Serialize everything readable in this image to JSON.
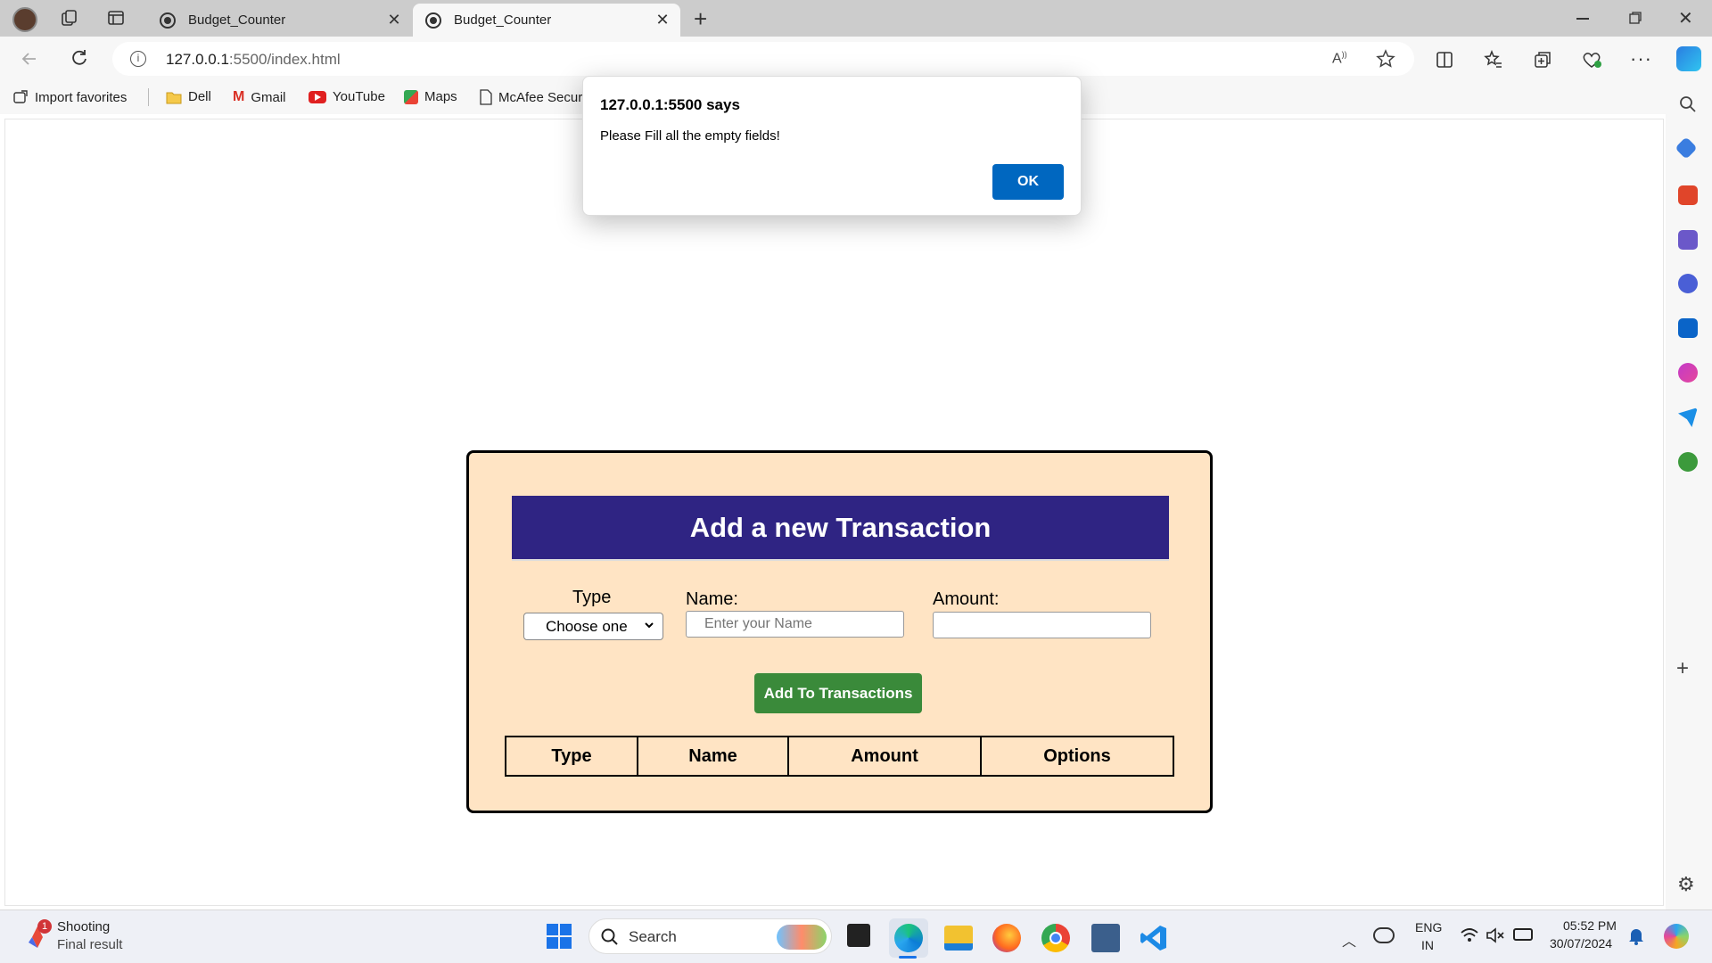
{
  "browser": {
    "tabs": [
      {
        "title": "Budget_Counter",
        "active": false
      },
      {
        "title": "Budget_Counter",
        "active": true
      }
    ],
    "url_host": "127.0.0.1",
    "url_rest": ":5500/index.html",
    "favorites": [
      "Import favorites",
      "Dell",
      "Gmail",
      "YouTube",
      "Maps",
      "McAfee Secur"
    ]
  },
  "dialog": {
    "title": "127.0.0.1:5500 says",
    "message": "Please Fill all the empty fields!",
    "ok_label": "OK"
  },
  "form": {
    "heading": "Add a new Transaction",
    "type_label": "Type",
    "type_selected": "Choose one",
    "name_label": "Name:",
    "name_placeholder": "Enter your Name",
    "amount_label": "Amount:",
    "amount_value": "",
    "submit_label": "Add To Transactions"
  },
  "table": {
    "headers": [
      "Type",
      "Name",
      "Amount",
      "Options"
    ]
  },
  "taskbar": {
    "notification_title": "Shooting",
    "notification_sub": "Final result",
    "notification_badge": "1",
    "search_label": "Search",
    "lang_line1": "ENG",
    "lang_line2": "IN",
    "time": "05:52 PM",
    "date": "30/07/2024"
  },
  "colors": {
    "card_bg": "#ffe4c4",
    "header_bg": "#2f2483",
    "button_bg": "#3a8a3a",
    "ok_button_bg": "#0067c0"
  }
}
